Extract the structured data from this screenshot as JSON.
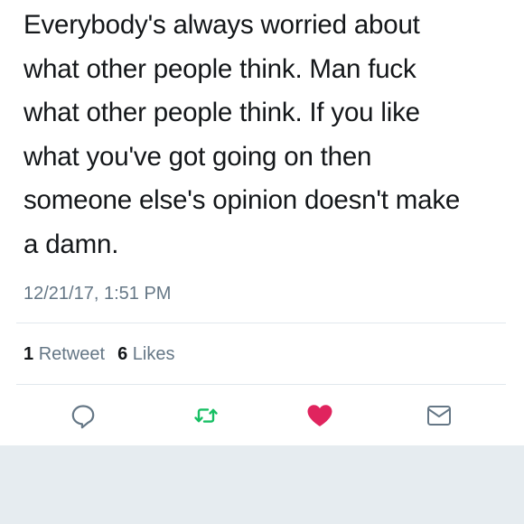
{
  "tweet": {
    "lines": [
      "Everybody's always worried about",
      "what other people think. Man fuck",
      "what other people think. If you like",
      "what you've got going on then",
      "someone else's opinion doesn't make",
      "a damn."
    ],
    "timestamp": "12/21/17, 1:51 PM"
  },
  "stats": {
    "retweet_count": "1",
    "retweet_label": "Retweet",
    "like_count": "6",
    "like_label": "Likes"
  },
  "actions": {
    "reply_icon": "reply-icon",
    "retweet_icon": "retweet-icon",
    "like_icon": "heart-icon",
    "dm_icon": "envelope-icon"
  },
  "colors": {
    "text": "#14171a",
    "muted": "#657786",
    "retweet_green": "#17bf63",
    "like_red": "#e0245e",
    "background": "#e6ecf0"
  }
}
